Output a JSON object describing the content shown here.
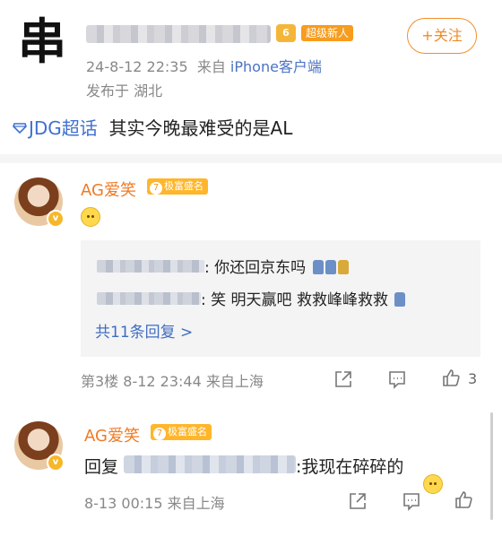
{
  "post": {
    "avatar_char": "串",
    "level_badge": "6",
    "super_badge": "超级新人",
    "follow_label": "+关注",
    "meta_time": "24-8-12 22:35",
    "meta_from": "来自",
    "meta_source": "iPhone客户端",
    "location": "发布于 湖北",
    "topic": "JDG超话",
    "text": "其实今晚最难受的是AL"
  },
  "comments": [
    {
      "name": "AG爱笑",
      "level": "7",
      "tag": "极富盛名",
      "replies": [
        {
          "text": ": 你还回京东吗"
        },
        {
          "text": ": 笑 明天赢吧 救救峰峰救救"
        }
      ],
      "more": "共11条回复 >",
      "floor": "第3楼",
      "time": "8-12 23:44",
      "source": "来自上海",
      "likes": "3"
    },
    {
      "name": "AG爱笑",
      "level": "7",
      "tag": "极富盛名",
      "reply_prefix": "回复",
      "reply_text": ":我现在碎碎的",
      "time": "8-13 00:15",
      "source": "来自上海"
    }
  ],
  "icons": {
    "share": "share-icon",
    "comment": "comment-icon",
    "like": "thumbs-up-icon",
    "topic": "diamond-icon"
  },
  "colors": {
    "accent": "#f08a24",
    "link": "#3f70d0",
    "name": "#f07a24"
  }
}
